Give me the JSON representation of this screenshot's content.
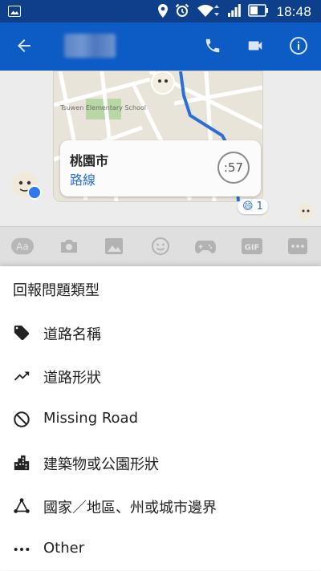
{
  "status_bar": {
    "time": "18:48"
  },
  "app_bar": {
    "title": ""
  },
  "location_card": {
    "city": "桃園市",
    "route": "路線",
    "timer": ":57"
  },
  "reaction": {
    "emoji": "😄",
    "count": "1"
  },
  "map_labels": {
    "school": "Tsuwen Elementary School"
  },
  "composer": {
    "aa": "Aa",
    "gif": "GIF"
  },
  "report_sheet": {
    "title": "回報問題類型",
    "options": [
      {
        "label": "道路名稱",
        "icon": "tag-icon"
      },
      {
        "label": "道路形狀",
        "icon": "trending-up-icon"
      },
      {
        "label": "Missing Road",
        "icon": "block-icon"
      },
      {
        "label": "建築物或公園形狀",
        "icon": "buildings-icon"
      },
      {
        "label": "國家／地區、州或城市邊界",
        "icon": "network-triangle-icon"
      },
      {
        "label": "Other",
        "icon": "more-horizontal-icon"
      }
    ]
  },
  "colors": {
    "status_bar": "#0D3F8A",
    "app_bar": "#0D5BC4",
    "route_blue": "#2b6fd6"
  }
}
